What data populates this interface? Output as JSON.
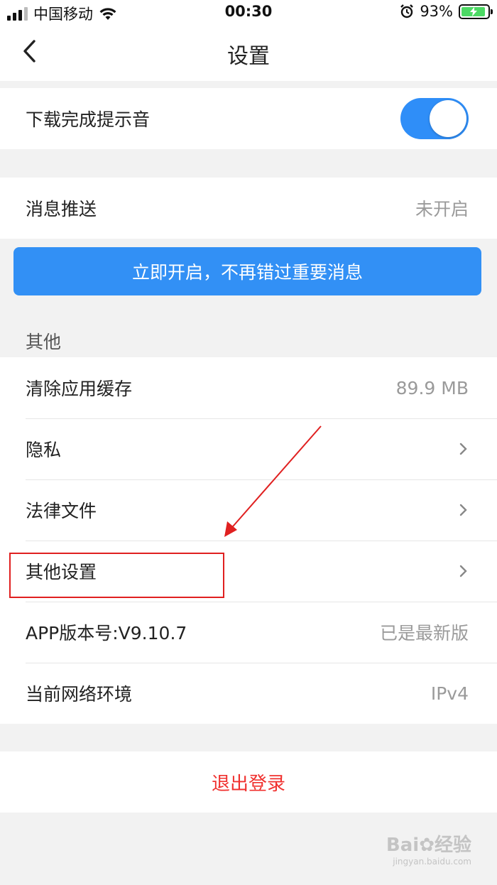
{
  "status_bar": {
    "carrier": "中国移动",
    "time": "00:30",
    "battery_percent": "93%",
    "battery_level": 0.93
  },
  "nav": {
    "title": "设置",
    "back_icon": "chevron-left-icon"
  },
  "download_section": {
    "label": "下载完成提示音",
    "toggle_on": true
  },
  "push_section": {
    "label": "消息推送",
    "value": "未开启",
    "enable_button": "立即开启，不再错过重要消息"
  },
  "other_section": {
    "header": "其他",
    "rows": [
      {
        "label": "清除应用缓存",
        "value": "89.9 MB"
      },
      {
        "label": "隐私"
      },
      {
        "label": "法律文件"
      },
      {
        "label": "其他设置"
      },
      {
        "label": "APP版本号:V9.10.7",
        "value": "已是最新版"
      },
      {
        "label": "当前网络环境",
        "value": "IPv4"
      }
    ]
  },
  "logout": {
    "label": "退出登录"
  },
  "watermark": {
    "brand": "Bai",
    "brand2": "经验",
    "url": "jingyan.baidu.com"
  },
  "colors": {
    "accent": "#3290f5",
    "toggle": "#2f8ef8",
    "logout": "#f0302e",
    "annotation": "#e02020"
  }
}
